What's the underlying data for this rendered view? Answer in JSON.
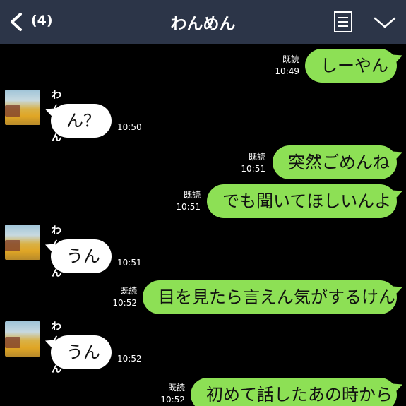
{
  "header": {
    "unread_count": "(4)",
    "title": "わんめん"
  },
  "colors": {
    "header_bg": "#2c3548",
    "background": "#000000",
    "outgoing_bubble": "#8de055",
    "incoming_bubble": "#ffffff"
  },
  "icons": {
    "back": "chevron-left-icon",
    "notes": "notes-icon",
    "menu": "chevron-down-icon"
  },
  "messages": [
    {
      "direction": "out",
      "text": "しーやん",
      "read": "既読",
      "time": "10:49"
    },
    {
      "direction": "in",
      "sender": "わんめん",
      "text": "ん？",
      "time": "10:50"
    },
    {
      "direction": "out",
      "text": "突然ごめんね",
      "read": "既読",
      "time": "10:51"
    },
    {
      "direction": "out",
      "text": "でも聞いてほしいんよ",
      "read": "既読",
      "time": "10:51"
    },
    {
      "direction": "in",
      "sender": "わんめん",
      "text": "うん",
      "time": "10:51"
    },
    {
      "direction": "out",
      "text": "目を見たら言えん気がするけん",
      "read": "既読",
      "time": "10:52"
    },
    {
      "direction": "in",
      "sender": "わんめん",
      "text": "うん",
      "time": "10:52"
    },
    {
      "direction": "out",
      "text": "初めて話したあの時から",
      "read": "既読",
      "time": "10:52"
    }
  ]
}
